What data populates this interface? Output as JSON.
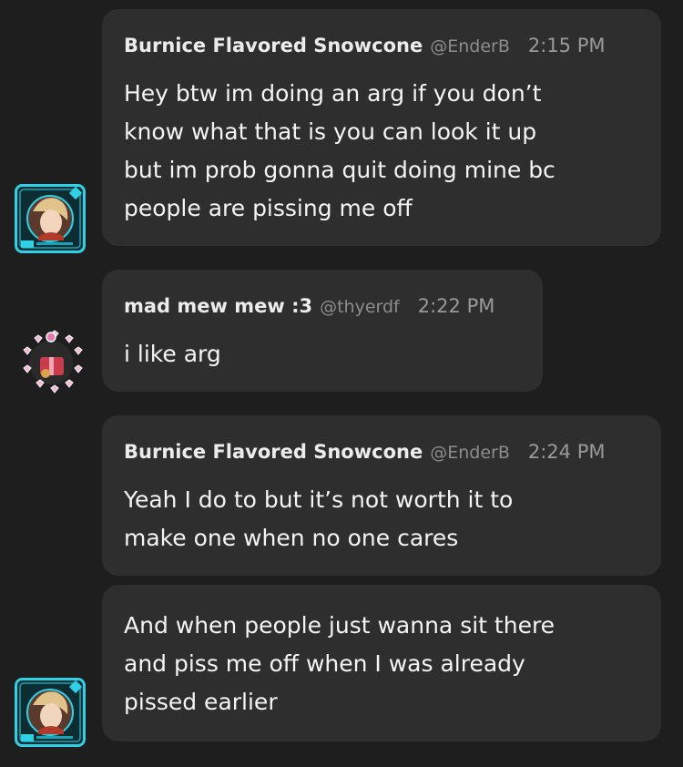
{
  "messages": [
    {
      "author": "Burnice Flavored Snowcone",
      "handle": "@EnderB",
      "time": "2:15 PM",
      "lines": [
        "Hey btw im doing an arg if you don’t",
        "know what that is you can look it up",
        "but im prob gonna quit doing mine bc",
        "people are pissing me off"
      ]
    },
    {
      "author": "mad mew mew :3",
      "handle": "@thyerdf",
      "time": "2:22 PM",
      "lines": [
        "i like arg"
      ]
    },
    {
      "author": "Burnice Flavored Snowcone",
      "handle": "@EnderB",
      "time": "2:24 PM",
      "lines": [
        "Yeah I do to but it’s not worth it to",
        "make one when no one cares"
      ]
    },
    {
      "lines": [
        "And when people just wanna sit there",
        "and piss me off when I was already",
        "pissed earlier"
      ]
    }
  ],
  "colors": {
    "background": "#1e1e1e",
    "bubble": "#2e2e2e",
    "card_frame": "#2fd1e6",
    "heart_badge": "#e27bb2"
  },
  "icons": {
    "avatar_burnice": "profile-card-avatar",
    "avatar_madmew": "heart-ring-avatar"
  }
}
